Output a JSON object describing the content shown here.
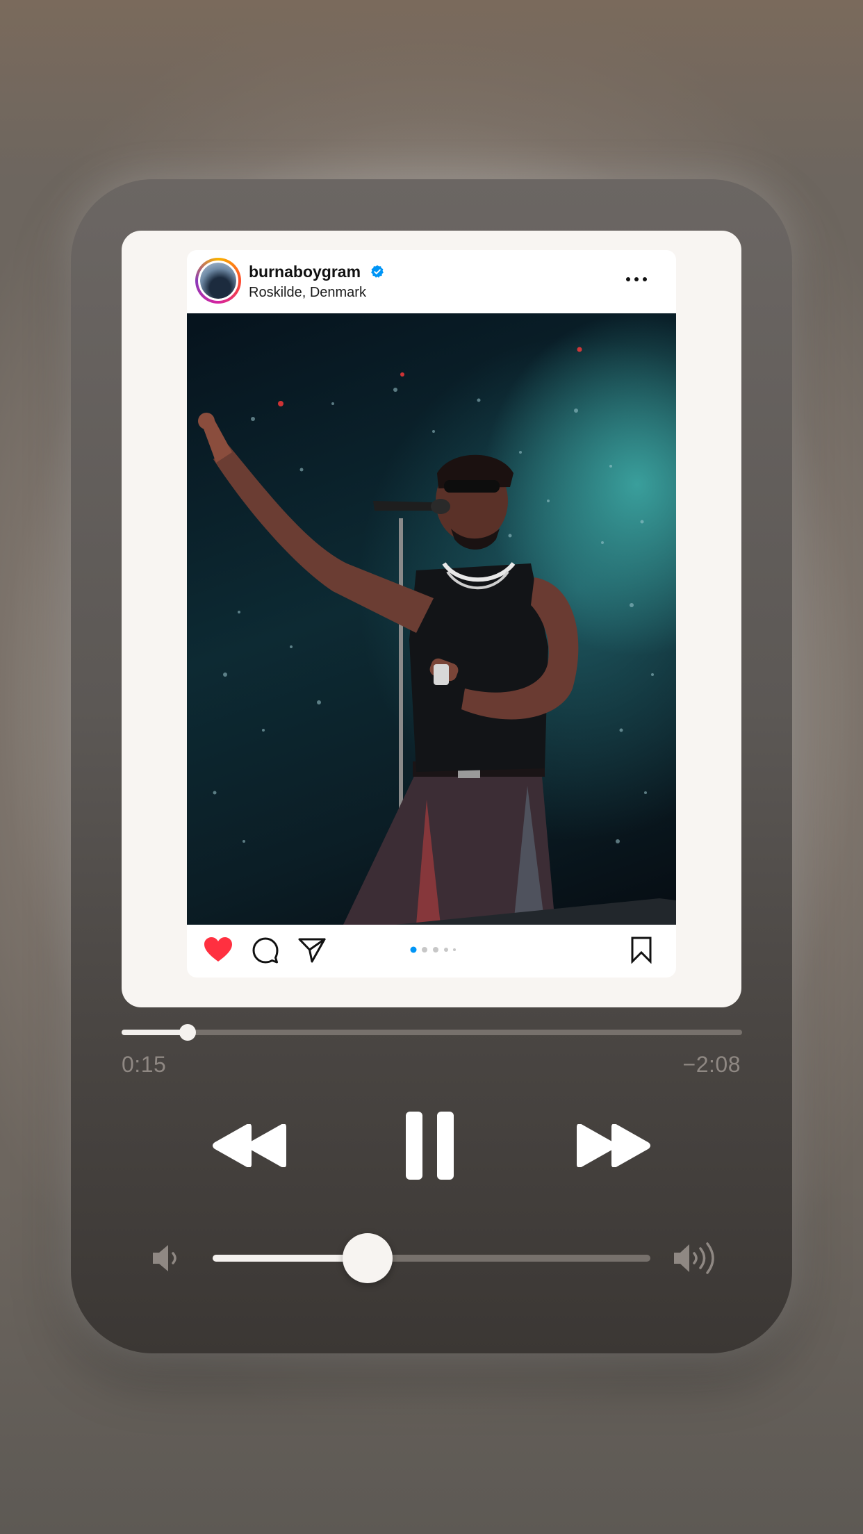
{
  "post": {
    "username": "burnaboygram",
    "location": "Roskilde, Denmark",
    "photo_subject": "performer singing into microphone on stage",
    "carousel_pages": 5,
    "carousel_active_index": 0,
    "liked": true
  },
  "player": {
    "elapsed": "0:15",
    "remaining": "−2:08",
    "progress_fraction": 0.106,
    "volume_fraction": 0.354,
    "state": "playing"
  },
  "icons": {
    "verified": "verified-badge-icon",
    "more": "more-options-icon",
    "like": "heart-icon",
    "comment": "comment-icon",
    "share": "send-icon",
    "save": "bookmark-icon",
    "rewind": "rewind-icon",
    "pause": "pause-icon",
    "forward": "fast-forward-icon",
    "volume_low": "volume-low-icon",
    "volume_high": "volume-high-icon"
  },
  "colors": {
    "like": "#ff3040",
    "verified": "#0095f6",
    "carousel_active": "#0095f6"
  }
}
